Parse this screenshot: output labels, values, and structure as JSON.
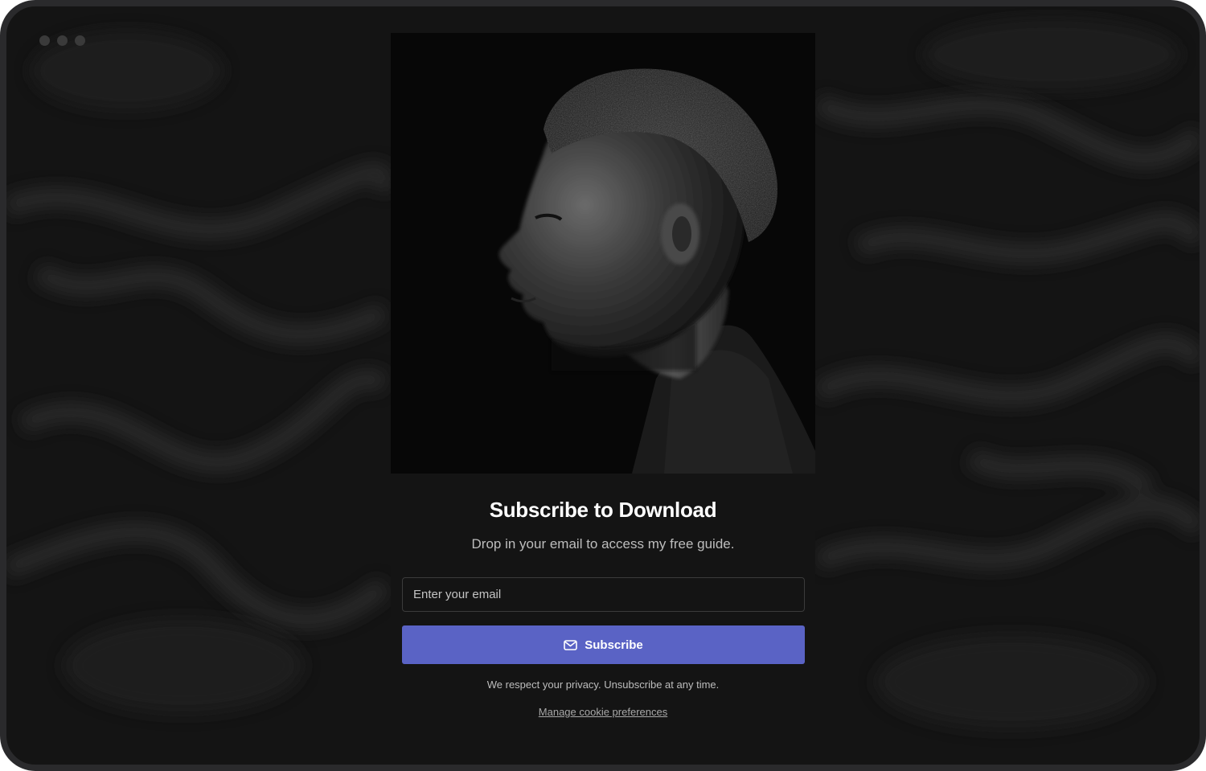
{
  "window": {
    "controls": [
      "dot",
      "dot",
      "dot"
    ]
  },
  "hero": {
    "photo_description_icon": "portrait-photo"
  },
  "form": {
    "title": "Subscribe to Download",
    "subtitle": "Drop in your email to access my free guide.",
    "email_placeholder": "Enter your email",
    "email_value": "",
    "subscribe_label": "Subscribe",
    "subscribe_icon": "mail-icon",
    "privacy_text": "We respect your privacy. Unsubscribe at any time.",
    "cookie_link": "Manage cookie preferences"
  },
  "colors": {
    "background": "#141414",
    "button": "#5a63c5",
    "frame": "#2a2a2c"
  }
}
